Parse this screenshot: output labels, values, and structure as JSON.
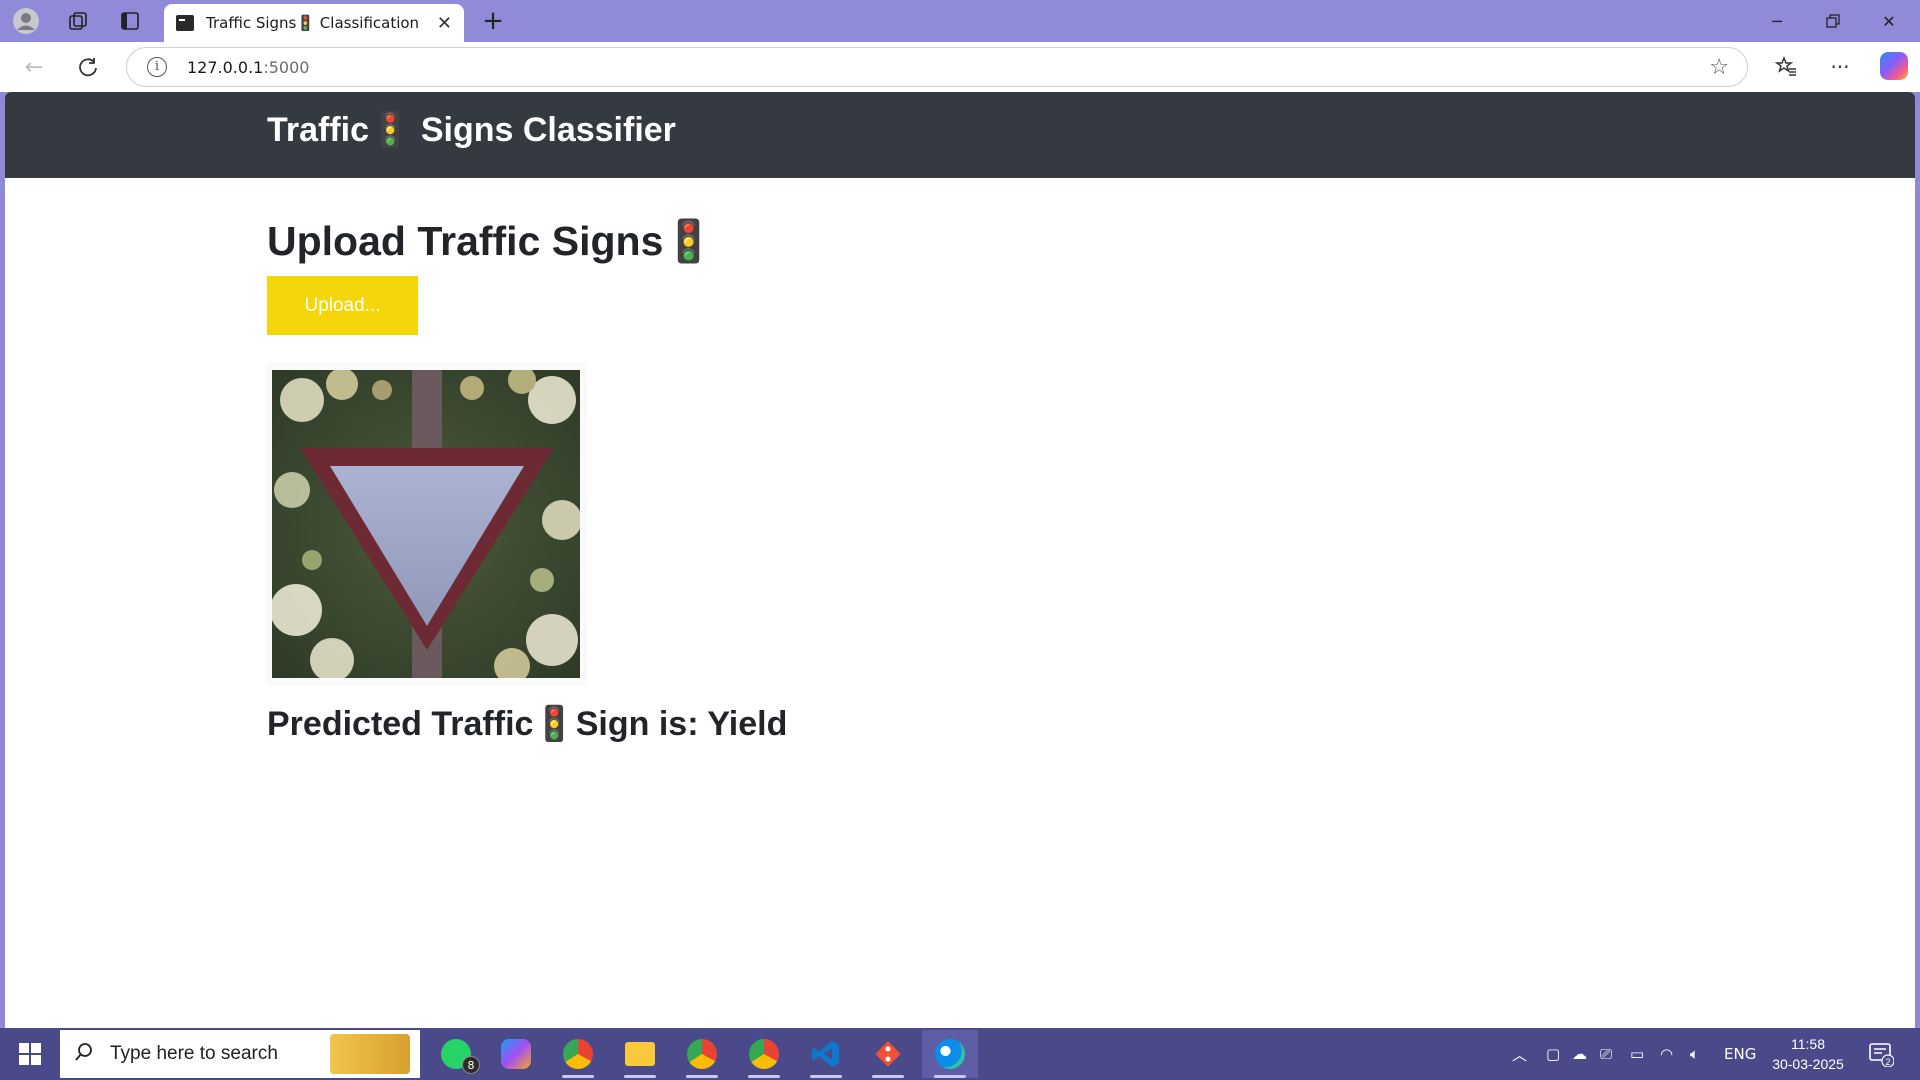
{
  "browser": {
    "tab_title": "Traffic Signs🚦 Classification",
    "url_host": "127.0.0.1",
    "url_port": ":5000"
  },
  "page": {
    "brand": "Traffic🚦 Signs Classifier",
    "heading": "Upload Traffic Signs🚦",
    "upload_label": "Upload...",
    "prediction": "Predicted Traffic🚦Sign is: Yield"
  },
  "taskbar": {
    "search_placeholder": "Type here to search",
    "whatsapp_badge": "8",
    "notification_count": "2",
    "language": "ENG",
    "time": "11:58",
    "date": "30-03-2025"
  },
  "colors": {
    "navbar": "#343a40",
    "upload_button": "#f5d60b",
    "tab_strip": "#8f8bd9",
    "taskbar": "#4a4a8a"
  },
  "icons": [
    "profile-icon",
    "workspaces-icon",
    "tab-actions-icon",
    "back-icon",
    "refresh-icon",
    "site-info-icon",
    "favorite-star-icon",
    "favorites-icon",
    "more-icon",
    "copilot-icon",
    "windows-start-icon",
    "search-icon",
    "whatsapp-icon",
    "m365-icon",
    "chrome-icon",
    "file-explorer-icon",
    "vscode-icon",
    "git-icon",
    "edge-icon",
    "wifi-icon",
    "volume-icon",
    "battery-icon",
    "notification-icon"
  ]
}
